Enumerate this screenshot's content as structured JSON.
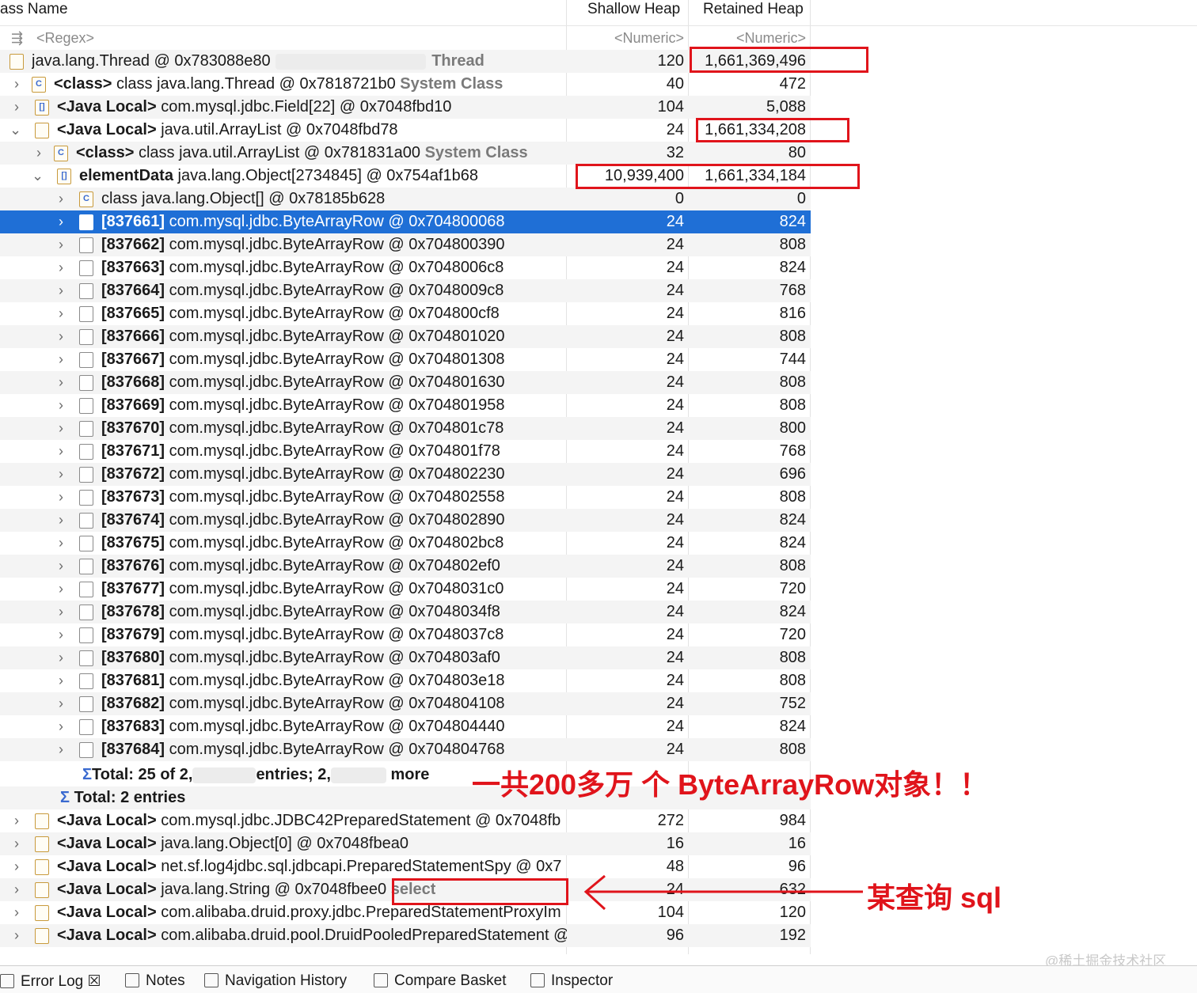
{
  "columns": {
    "name": "ass Name",
    "shallow": "Shallow Heap",
    "retained": "Retained Heap"
  },
  "filter": {
    "name": "<Regex>",
    "shallow": "<Numeric>",
    "retained": "<Numeric>"
  },
  "rows": [
    {
      "pre": "",
      "name": "java.lang.Thread @ 0x783088e80",
      "suffix": "Thread",
      "shallow": "120",
      "retained": "1,661,369,496"
    },
    {
      "pre": "<class>",
      "name": "class java.lang.Thread @ 0x7818721b0",
      "suffix": "System Class",
      "shallow": "40",
      "retained": "472"
    },
    {
      "pre": "<Java Local>",
      "name": "com.mysql.jdbc.Field[22] @ 0x7048fbd10",
      "suffix": "",
      "shallow": "104",
      "retained": "5,088"
    },
    {
      "pre": "<Java Local>",
      "name": "java.util.ArrayList @ 0x7048fbd78",
      "suffix": "",
      "shallow": "24",
      "retained": "1,661,334,208"
    },
    {
      "pre": "<class>",
      "name": "class java.util.ArrayList @ 0x781831a00",
      "suffix": "System Class",
      "shallow": "32",
      "retained": "80"
    },
    {
      "pre": "elementData",
      "name": "java.lang.Object[2734845] @ 0x754af1b68",
      "suffix": "",
      "shallow": "10,939,400",
      "retained": "1,661,334,184"
    },
    {
      "pre": "",
      "name": "class java.lang.Object[] @ 0x78185b628",
      "suffix": "",
      "shallow": "0",
      "retained": "0"
    },
    {
      "pre": "[837661]",
      "name": "com.mysql.jdbc.ByteArrayRow @ 0x704800068",
      "suffix": "",
      "shallow": "24",
      "retained": "824"
    },
    {
      "pre": "[837662]",
      "name": "com.mysql.jdbc.ByteArrayRow @ 0x704800390",
      "suffix": "",
      "shallow": "24",
      "retained": "808"
    },
    {
      "pre": "[837663]",
      "name": "com.mysql.jdbc.ByteArrayRow @ 0x7048006c8",
      "suffix": "",
      "shallow": "24",
      "retained": "824"
    },
    {
      "pre": "[837664]",
      "name": "com.mysql.jdbc.ByteArrayRow @ 0x7048009c8",
      "suffix": "",
      "shallow": "24",
      "retained": "768"
    },
    {
      "pre": "[837665]",
      "name": "com.mysql.jdbc.ByteArrayRow @ 0x704800cf8",
      "suffix": "",
      "shallow": "24",
      "retained": "816"
    },
    {
      "pre": "[837666]",
      "name": "com.mysql.jdbc.ByteArrayRow @ 0x704801020",
      "suffix": "",
      "shallow": "24",
      "retained": "808"
    },
    {
      "pre": "[837667]",
      "name": "com.mysql.jdbc.ByteArrayRow @ 0x704801308",
      "suffix": "",
      "shallow": "24",
      "retained": "744"
    },
    {
      "pre": "[837668]",
      "name": "com.mysql.jdbc.ByteArrayRow @ 0x704801630",
      "suffix": "",
      "shallow": "24",
      "retained": "808"
    },
    {
      "pre": "[837669]",
      "name": "com.mysql.jdbc.ByteArrayRow @ 0x704801958",
      "suffix": "",
      "shallow": "24",
      "retained": "808"
    },
    {
      "pre": "[837670]",
      "name": "com.mysql.jdbc.ByteArrayRow @ 0x704801c78",
      "suffix": "",
      "shallow": "24",
      "retained": "800"
    },
    {
      "pre": "[837671]",
      "name": "com.mysql.jdbc.ByteArrayRow @ 0x704801f78",
      "suffix": "",
      "shallow": "24",
      "retained": "768"
    },
    {
      "pre": "[837672]",
      "name": "com.mysql.jdbc.ByteArrayRow @ 0x704802230",
      "suffix": "",
      "shallow": "24",
      "retained": "696"
    },
    {
      "pre": "[837673]",
      "name": "com.mysql.jdbc.ByteArrayRow @ 0x704802558",
      "suffix": "",
      "shallow": "24",
      "retained": "808"
    },
    {
      "pre": "[837674]",
      "name": "com.mysql.jdbc.ByteArrayRow @ 0x704802890",
      "suffix": "",
      "shallow": "24",
      "retained": "824"
    },
    {
      "pre": "[837675]",
      "name": "com.mysql.jdbc.ByteArrayRow @ 0x704802bc8",
      "suffix": "",
      "shallow": "24",
      "retained": "824"
    },
    {
      "pre": "[837676]",
      "name": "com.mysql.jdbc.ByteArrayRow @ 0x704802ef0",
      "suffix": "",
      "shallow": "24",
      "retained": "808"
    },
    {
      "pre": "[837677]",
      "name": "com.mysql.jdbc.ByteArrayRow @ 0x7048031c0",
      "suffix": "",
      "shallow": "24",
      "retained": "720"
    },
    {
      "pre": "[837678]",
      "name": "com.mysql.jdbc.ByteArrayRow @ 0x7048034f8",
      "suffix": "",
      "shallow": "24",
      "retained": "824"
    },
    {
      "pre": "[837679]",
      "name": "com.mysql.jdbc.ByteArrayRow @ 0x7048037c8",
      "suffix": "",
      "shallow": "24",
      "retained": "720"
    },
    {
      "pre": "[837680]",
      "name": "com.mysql.jdbc.ByteArrayRow @ 0x704803af0",
      "suffix": "",
      "shallow": "24",
      "retained": "808"
    },
    {
      "pre": "[837681]",
      "name": "com.mysql.jdbc.ByteArrayRow @ 0x704803e18",
      "suffix": "",
      "shallow": "24",
      "retained": "808"
    },
    {
      "pre": "[837682]",
      "name": "com.mysql.jdbc.ByteArrayRow @ 0x704804108",
      "suffix": "",
      "shallow": "24",
      "retained": "752"
    },
    {
      "pre": "[837683]",
      "name": "com.mysql.jdbc.ByteArrayRow @ 0x704804440",
      "suffix": "",
      "shallow": "24",
      "retained": "824"
    },
    {
      "pre": "[837684]",
      "name": "com.mysql.jdbc.ByteArrayRow @ 0x704804768",
      "suffix": "",
      "shallow": "24",
      "retained": "808"
    },
    {
      "pre": "",
      "name": "",
      "suffix": "",
      "shallow": "",
      "retained": "",
      "total1": "Total: 25 of 2,",
      "total1b": "entries; 2,",
      "total1c": "more"
    },
    {
      "pre": "",
      "name": "",
      "suffix": "",
      "shallow": "",
      "retained": "",
      "total2": "Total: 2 entries"
    },
    {
      "pre": "<Java Local>",
      "name": "com.mysql.jdbc.JDBC42PreparedStatement @ 0x7048fb",
      "suffix": "",
      "shallow": "272",
      "retained": "984"
    },
    {
      "pre": "<Java Local>",
      "name": "java.lang.Object[0] @ 0x7048fbea0",
      "suffix": "",
      "shallow": "16",
      "retained": "16"
    },
    {
      "pre": "<Java Local>",
      "name": "net.sf.log4jdbc.sql.jdbcapi.PreparedStatementSpy @ 0x7",
      "suffix": "",
      "shallow": "48",
      "retained": "96"
    },
    {
      "pre": "<Java Local>",
      "name": "java.lang.String @ 0x7048fbee0",
      "suffix": "select",
      "shallow": "24",
      "retained": "632"
    },
    {
      "pre": "<Java Local>",
      "name": "com.alibaba.druid.proxy.jdbc.PreparedStatementProxyIm",
      "suffix": "",
      "shallow": "104",
      "retained": "120"
    },
    {
      "pre": "<Java Local>",
      "name": "com.alibaba.druid.pool.DruidPooledPreparedStatement @",
      "suffix": "",
      "shallow": "96",
      "retained": "192"
    }
  ],
  "annotations": {
    "total_note": "一共200多万 个 ByteArrayRow对象！！",
    "sql_note": "某查询  sql"
  },
  "tabs": [
    "Error Log",
    "Notes",
    "Navigation History",
    "Compare Basket",
    "Inspector"
  ],
  "watermark": "@稀土掘金技术社区",
  "colors": {
    "selection": "#1f6fd6",
    "annotation": "#e0141b"
  }
}
